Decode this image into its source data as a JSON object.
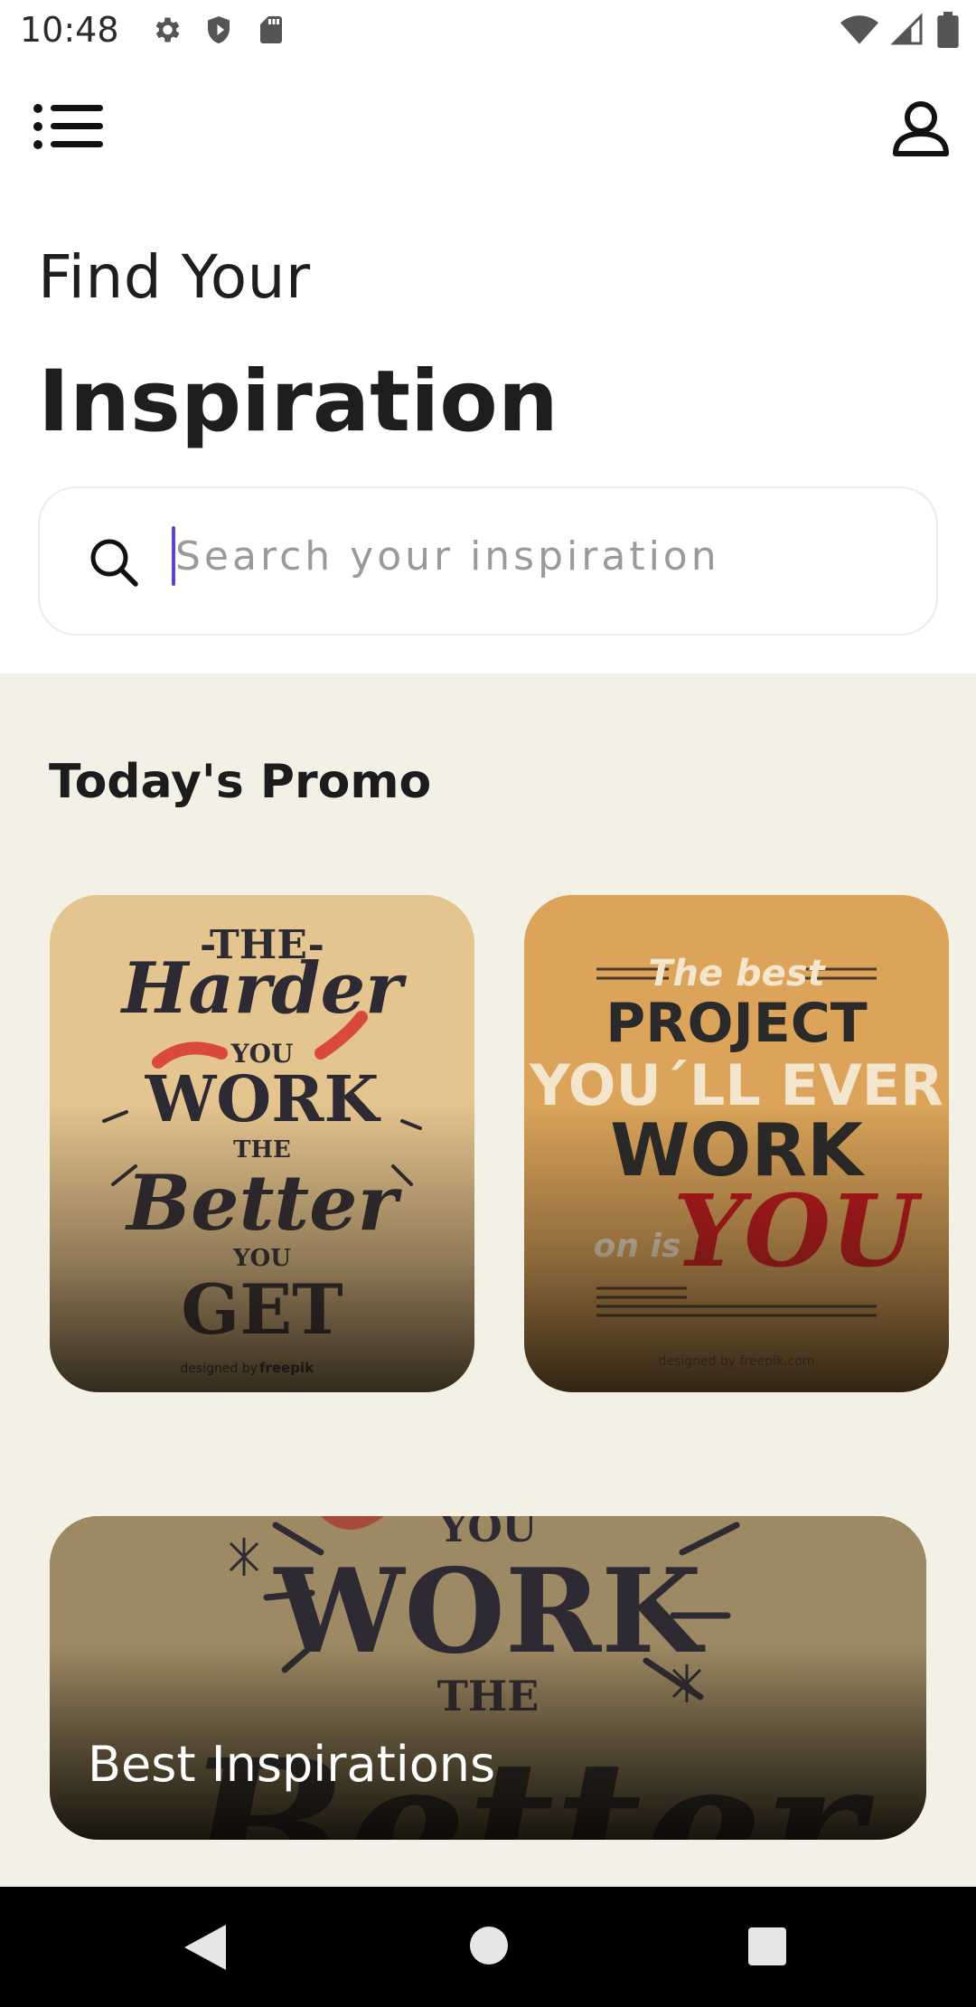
{
  "status_bar": {
    "time": "10:48",
    "left_icons": [
      "settings-icon",
      "shield-icon",
      "sd-card-icon"
    ],
    "right_icons": [
      "wifi-icon",
      "signal-icon",
      "battery-icon"
    ]
  },
  "app_bar": {
    "menu_icon": "menu-icon",
    "profile_icon": "person-icon"
  },
  "header": {
    "subtitle": "Find Your",
    "title": "Inspiration"
  },
  "search": {
    "placeholder": "Search your inspiration",
    "value": ""
  },
  "promo": {
    "section_title": "Today's Promo",
    "cards": [
      {
        "image_text": "The Harder you Work the Better you Get",
        "credit": "designed by freepik"
      },
      {
        "image_text": "The best PROJECT YOU´LL EVER WORK on is YOU",
        "credit": "designed by freepik.com"
      }
    ]
  },
  "best_inspirations": {
    "label": "Best Inspirations"
  },
  "nav_bar": {
    "back": "back-icon",
    "home": "home-icon",
    "recent": "recent-apps-icon"
  },
  "colors": {
    "accent": "#5a46c8",
    "section_bg": "#f3f1e6"
  }
}
